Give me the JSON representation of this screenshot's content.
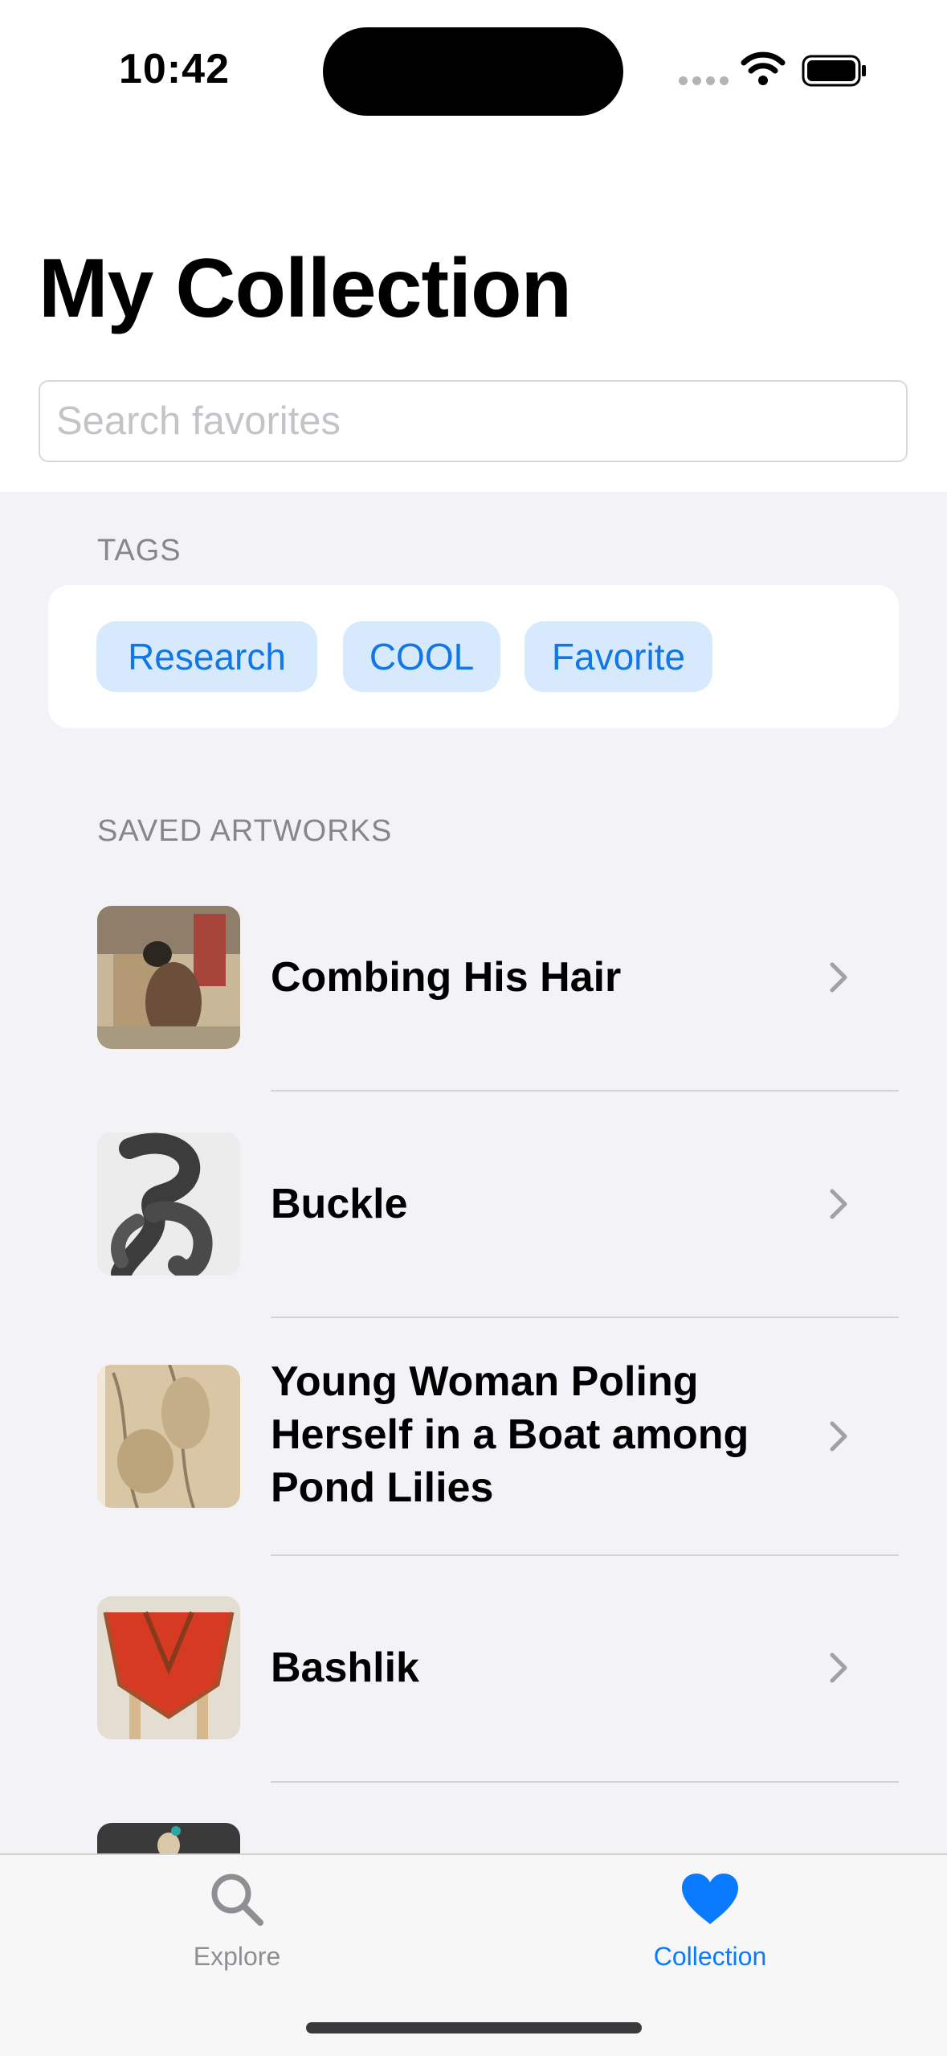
{
  "status_bar": {
    "time": "10:42"
  },
  "page": {
    "title": "My Collection"
  },
  "search": {
    "placeholder": "Search favorites",
    "value": ""
  },
  "tags_section": {
    "header": "TAGS",
    "tags": [
      "Research",
      "COOL",
      "Favorite"
    ]
  },
  "artworks_section": {
    "header": "SAVED ARTWORKS",
    "items": [
      {
        "title": "Combing His Hair"
      },
      {
        "title": "Buckle"
      },
      {
        "title": "Young Woman Poling Herself in a Boat among Pond Lilies"
      },
      {
        "title": "Bashlik"
      }
    ]
  },
  "tab_bar": {
    "tabs": [
      {
        "label": "Explore",
        "icon": "magnifier-icon",
        "active": false
      },
      {
        "label": "Collection",
        "icon": "heart-icon",
        "active": true
      }
    ]
  },
  "colors": {
    "accent": "#0a7aff",
    "tag_bg": "#d7eafd",
    "inactive": "#8e8e93"
  }
}
